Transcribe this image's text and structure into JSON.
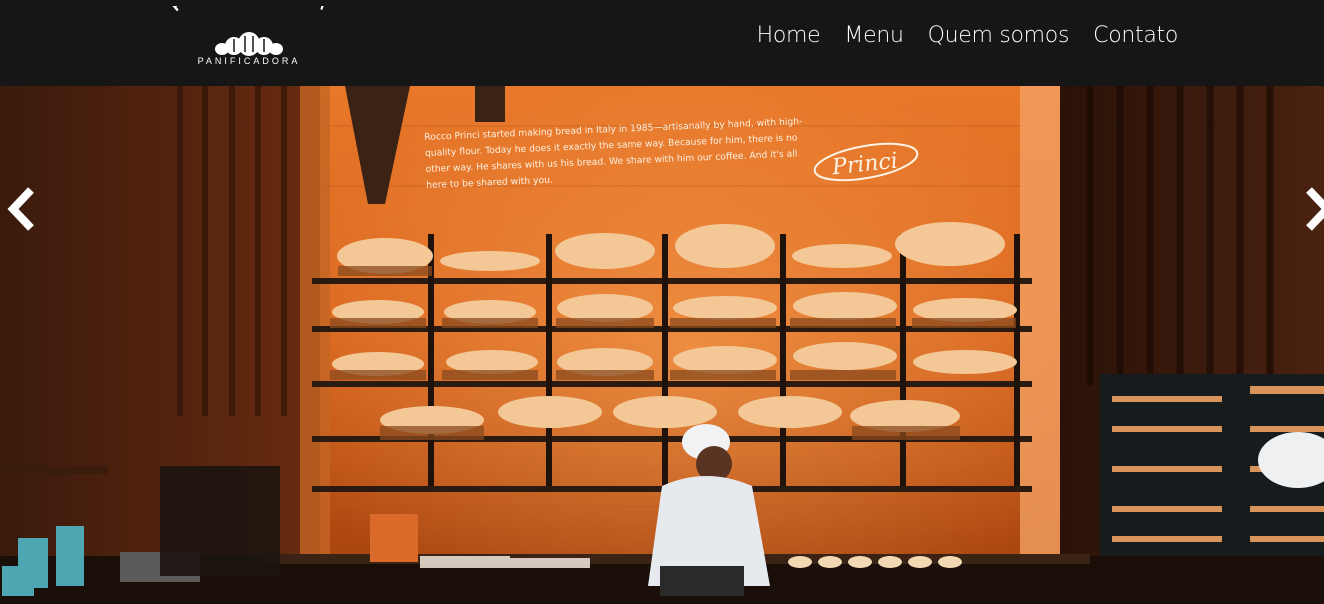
{
  "header": {
    "logo": {
      "arc_text": "PÃO AMIGO E CIA",
      "subtitle": "PANIFICADORA",
      "icon": "croissant-icon"
    },
    "nav": [
      {
        "label": "Home"
      },
      {
        "label": "Menu"
      },
      {
        "label": "Quem somos"
      },
      {
        "label": "Contato"
      }
    ]
  },
  "carousel": {
    "prev_icon": "chevron-left-icon",
    "next_icon": "chevron-right-icon",
    "slide": {
      "wall_text": "Rocco Princi started making bread in Italy in 1985—artisanally by hand, with high-quality flour. Today he does it exactly the same way. Because for him, there is no other way. He shares with us his bread. We share with him our coffee. And it's all here to be shared with you.",
      "signature": "Princi"
    }
  },
  "colors": {
    "header_bg": "#161616",
    "nav_text": "#ffffff",
    "warm_orange": "#d9641c"
  }
}
